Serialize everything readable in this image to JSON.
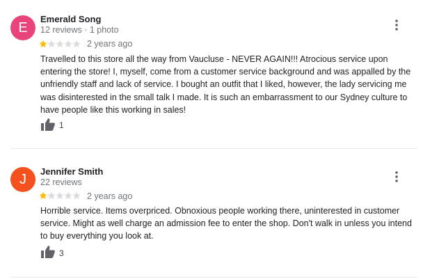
{
  "reviews": [
    {
      "initial": "E",
      "avatar_color": "#e8437b",
      "name": "Emerald Song",
      "meta": "12 reviews · 1 photo",
      "rating": 1,
      "max_rating": 5,
      "date": "2 years ago",
      "text": "Travelled to this store all the way from Vaucluse - NEVER AGAIN!!! Atrocious service upon entering the store! I, myself, come from a customer service background and was appalled by the unfriendly staff and lack of service. I bought an outfit that I liked, however, the lady servicing me was disinterested in the small talk I made. It is such an embarrassment to our Sydney culture to have people like this working in sales!",
      "likes": "1"
    },
    {
      "initial": "J",
      "avatar_color": "#f4511e",
      "name": "Jennifer Smith",
      "meta": "22 reviews",
      "rating": 1,
      "max_rating": 5,
      "date": "2 years ago",
      "text": "Horrible service. Items overpriced. Obnoxious people working there, uninterested in customer service. Might as well charge an admission fee to enter the shop. Don't walk in unless you intend to buy everything you look at.",
      "likes": "3"
    }
  ],
  "colors": {
    "star_filled": "#fbbc04",
    "star_empty": "#dadce0",
    "icon": "#5f6368"
  },
  "icons": {
    "menu": "more-vert-icon",
    "like": "thumb-up-icon",
    "star": "star-icon"
  }
}
